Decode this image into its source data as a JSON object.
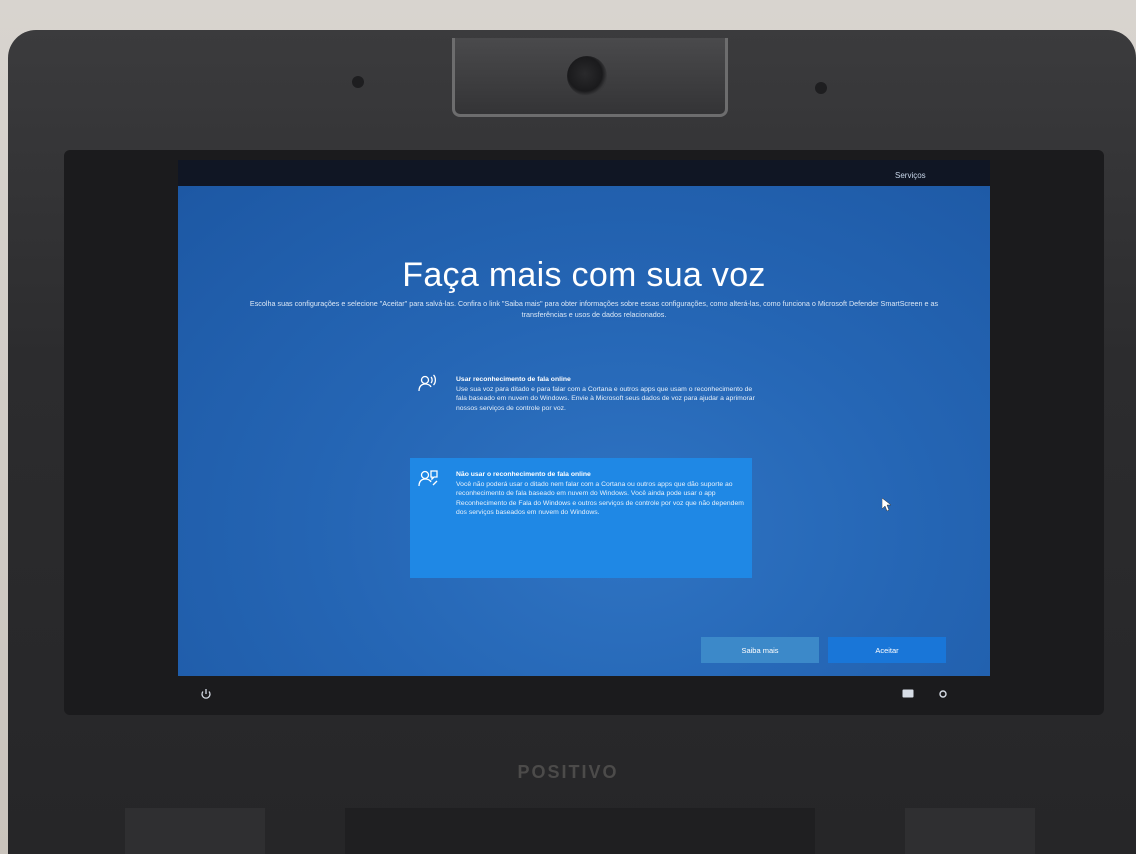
{
  "progress": {
    "label": "Serviços",
    "value": 1.0
  },
  "page": {
    "title": "Faça mais com sua voz",
    "subtitle": "Escolha suas configurações e selecione \"Aceitar\" para salvá-las. Confira o link \"Saiba mais\" para obter informações sobre essas configurações, como alterá-las, como funciona o Microsoft Defender SmartScreen e as transferências e usos de dados relacionados."
  },
  "options": [
    {
      "title": "Usar reconhecimento de fala online",
      "description": "Use sua voz para ditado e para falar com a Cortana e outros apps que usam o reconhecimento de fala baseado em nuvem do Windows. Envie à Microsoft seus dados de voz para ajudar a aprimorar nossos serviços de controle por voz.",
      "icon": "speech-online-icon",
      "selected": false
    },
    {
      "title": "Não usar o reconhecimento de fala online",
      "description": "Você não poderá usar o ditado nem falar com a Cortana ou outros apps que dão suporte ao reconhecimento de fala baseado em nuvem do Windows. Você ainda pode usar o app Reconhecimento de Fala do Windows e outros serviços de controle por voz que não dependem dos serviços baseados em nuvem do Windows.",
      "icon": "speech-offline-icon",
      "selected": true
    }
  ],
  "buttons": {
    "learn_more": "Saiba mais",
    "accept": "Aceitar"
  },
  "bottom_icons": {
    "left": "accessibility-icon",
    "right": [
      "keyboard-icon",
      "network-icon"
    ]
  },
  "device": {
    "brand": "POSITIVO"
  },
  "colors": {
    "screen_bg": "#2566b5",
    "selected_option": "#1f88e5",
    "accept_button": "#1976d8",
    "learn_more_button": "#3c89c9"
  }
}
